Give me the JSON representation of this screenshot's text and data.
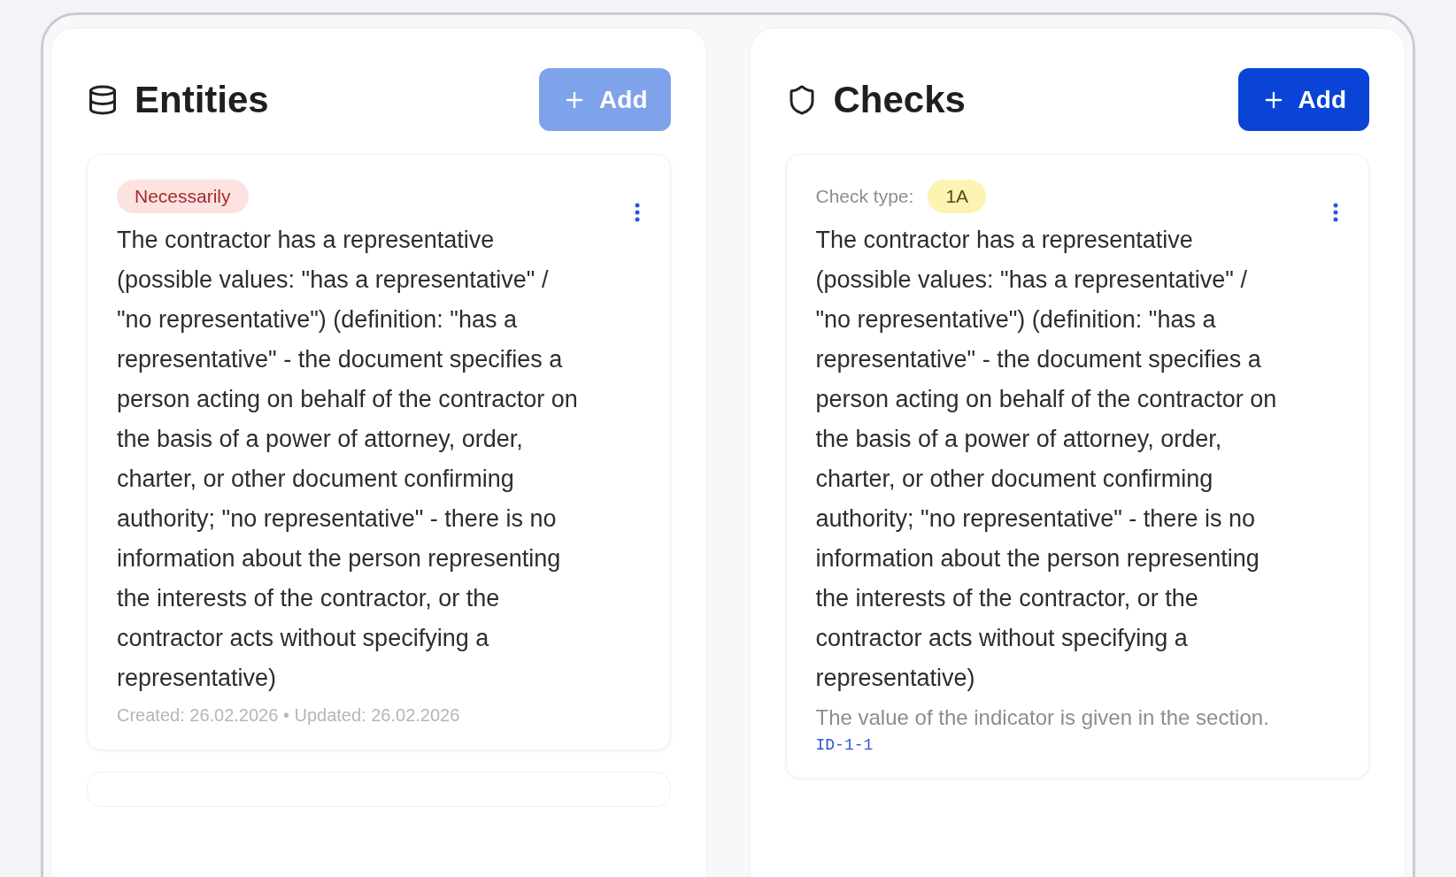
{
  "panels": [
    {
      "kind": "entities",
      "title": "Entities",
      "add_button": {
        "label": "Add",
        "disabled": true
      },
      "cards": [
        {
          "tag": "Necessarily",
          "text": "The contractor has a representative (possible values: \"has a representative\" / \"no representative\") (definition: \"has a representative\" - the document specifies a person acting on behalf of the contractor on the basis of a power of attorney, order, charter, or other document confirming authority; \"no representative\" - there is no information about the person representing the interests of the contractor, or the contractor acts without specifying a representative)",
          "meta": "Created: 26.02.2026 • Updated: 26.02.2026"
        }
      ],
      "more_cards_below": true
    },
    {
      "kind": "checks",
      "title": "Checks",
      "add_button": {
        "label": "Add",
        "disabled": false
      },
      "cards": [
        {
          "type_label": "Check type:",
          "type_value": "1A",
          "text": "The contractor has a representative (possible values: \"has a representative\" / \"no representative\") (definition: \"has a representative\" - the document specifies a person acting on behalf of the contractor on the basis of a power of attorney, order, charter, or other document confirming authority; \"no representative\" - there is no information about the person representing the interests of the contractor, or the contractor acts without specifying a representative)",
          "hint": "The value of the indicator is given in the section.",
          "id": "ID-1-1"
        }
      ],
      "more_cards_below": false
    }
  ]
}
